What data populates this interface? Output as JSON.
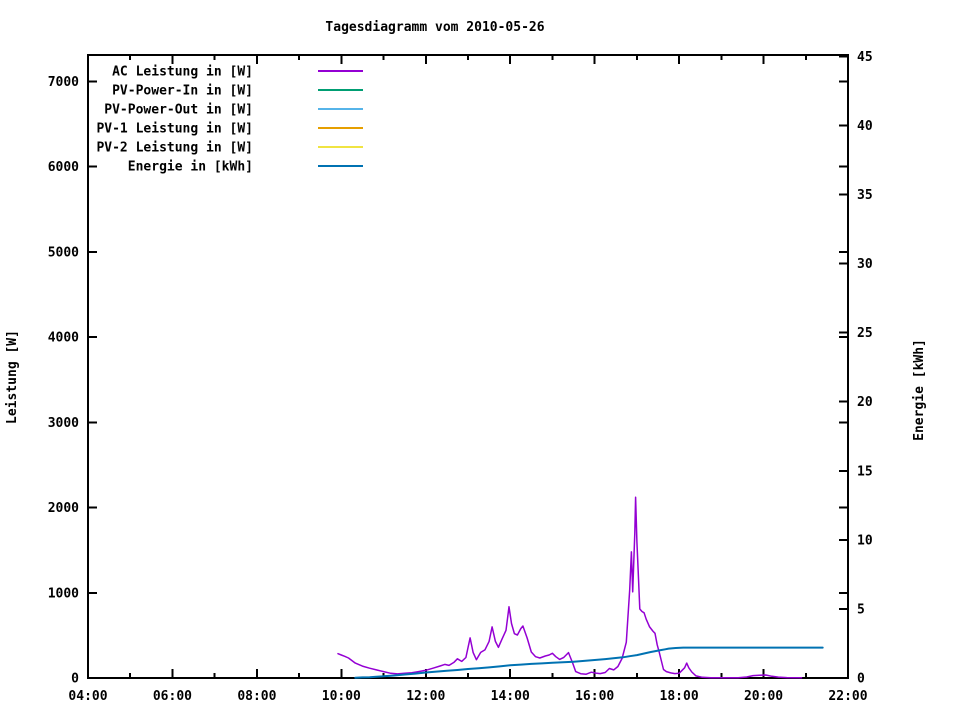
{
  "chart_data": {
    "type": "line",
    "title": "Tagesdiagramm vom 2010-05-26",
    "grid": false,
    "legend_position": "top-left-inside",
    "background_color": "#ffffff",
    "frame_color": "#000000",
    "x": {
      "range_hours": [
        4,
        22
      ],
      "tick_hours": [
        4,
        6,
        8,
        10,
        12,
        14,
        16,
        18,
        20,
        22
      ],
      "tick_labels": [
        "04:00",
        "06:00",
        "08:00",
        "10:00",
        "12:00",
        "14:00",
        "16:00",
        "18:00",
        "20:00",
        "22:00"
      ],
      "minor_tick_hours": [
        5,
        7,
        9,
        11,
        13,
        15,
        17,
        19,
        21
      ]
    },
    "y_left": {
      "label": "Leistung [W]",
      "ticks": [
        0,
        1000,
        2000,
        3000,
        4000,
        5000,
        6000,
        7000
      ],
      "range": [
        0,
        7310
      ]
    },
    "y_right": {
      "label": "Energie [kWh]",
      "ticks": [
        0,
        5,
        10,
        15,
        20,
        25,
        30,
        35,
        40,
        45
      ],
      "range": [
        0,
        45.1
      ]
    },
    "series": [
      {
        "name": "AC Leistung in [W]",
        "color": "#9400d3",
        "axis": "left",
        "points": [
          [
            9.92,
            285
          ],
          [
            10.0,
            270
          ],
          [
            10.08,
            255
          ],
          [
            10.17,
            235
          ],
          [
            10.33,
            175
          ],
          [
            10.5,
            140
          ],
          [
            10.67,
            115
          ],
          [
            10.83,
            95
          ],
          [
            11.0,
            75
          ],
          [
            11.17,
            55
          ],
          [
            11.33,
            48
          ],
          [
            11.5,
            55
          ],
          [
            11.67,
            62
          ],
          [
            11.83,
            75
          ],
          [
            12.0,
            90
          ],
          [
            12.17,
            115
          ],
          [
            12.33,
            140
          ],
          [
            12.45,
            160
          ],
          [
            12.55,
            148
          ],
          [
            12.67,
            185
          ],
          [
            12.75,
            225
          ],
          [
            12.85,
            195
          ],
          [
            12.95,
            240
          ],
          [
            13.05,
            470
          ],
          [
            13.12,
            300
          ],
          [
            13.2,
            215
          ],
          [
            13.3,
            300
          ],
          [
            13.4,
            330
          ],
          [
            13.5,
            430
          ],
          [
            13.57,
            600
          ],
          [
            13.65,
            430
          ],
          [
            13.72,
            360
          ],
          [
            13.8,
            450
          ],
          [
            13.9,
            560
          ],
          [
            13.97,
            835
          ],
          [
            14.03,
            640
          ],
          [
            14.1,
            520
          ],
          [
            14.17,
            505
          ],
          [
            14.25,
            580
          ],
          [
            14.3,
            610
          ],
          [
            14.4,
            470
          ],
          [
            14.5,
            305
          ],
          [
            14.6,
            250
          ],
          [
            14.7,
            235
          ],
          [
            14.83,
            258
          ],
          [
            14.92,
            270
          ],
          [
            15.0,
            290
          ],
          [
            15.08,
            250
          ],
          [
            15.17,
            218
          ],
          [
            15.27,
            242
          ],
          [
            15.38,
            298
          ],
          [
            15.48,
            175
          ],
          [
            15.55,
            75
          ],
          [
            15.67,
            50
          ],
          [
            15.8,
            45
          ],
          [
            15.92,
            68
          ],
          [
            16.03,
            58
          ],
          [
            16.13,
            52
          ],
          [
            16.25,
            65
          ],
          [
            16.35,
            112
          ],
          [
            16.45,
            95
          ],
          [
            16.55,
            135
          ],
          [
            16.65,
            230
          ],
          [
            16.75,
            420
          ],
          [
            16.83,
            1035
          ],
          [
            16.87,
            1480
          ],
          [
            16.9,
            1010
          ],
          [
            16.95,
            1700
          ],
          [
            16.97,
            2120
          ],
          [
            17.0,
            1600
          ],
          [
            17.03,
            1250
          ],
          [
            17.07,
            810
          ],
          [
            17.12,
            780
          ],
          [
            17.17,
            765
          ],
          [
            17.22,
            690
          ],
          [
            17.3,
            600
          ],
          [
            17.38,
            550
          ],
          [
            17.43,
            525
          ],
          [
            17.48,
            390
          ],
          [
            17.53,
            300
          ],
          [
            17.58,
            200
          ],
          [
            17.63,
            100
          ],
          [
            17.7,
            75
          ],
          [
            17.8,
            60
          ],
          [
            17.9,
            52
          ],
          [
            18.0,
            55
          ],
          [
            18.07,
            90
          ],
          [
            18.13,
            120
          ],
          [
            18.18,
            175
          ],
          [
            18.23,
            120
          ],
          [
            18.3,
            70
          ],
          [
            18.4,
            25
          ],
          [
            18.55,
            8
          ],
          [
            18.75,
            2
          ],
          [
            19.4,
            2
          ],
          [
            19.6,
            12
          ],
          [
            19.75,
            28
          ],
          [
            19.9,
            32
          ],
          [
            20.05,
            35
          ],
          [
            20.2,
            20
          ],
          [
            20.35,
            10
          ],
          [
            20.55,
            5
          ],
          [
            20.9,
            2
          ]
        ]
      },
      {
        "name": "PV-Power-In in [W]",
        "color": "#009e73",
        "axis": "left",
        "points": []
      },
      {
        "name": "PV-Power-Out in [W]",
        "color": "#56b4e9",
        "axis": "left",
        "points": []
      },
      {
        "name": "PV-1 Leistung in [W]",
        "color": "#e69f00",
        "axis": "left",
        "points": []
      },
      {
        "name": "PV-2 Leistung in [W]",
        "color": "#f0e442",
        "axis": "left",
        "points": []
      },
      {
        "name": "Energie in [kWh]",
        "color": "#0072b2",
        "axis": "right",
        "points": [
          [
            10.33,
            0.02
          ],
          [
            10.5,
            0.04
          ],
          [
            10.67,
            0.06
          ],
          [
            10.83,
            0.09
          ],
          [
            11.0,
            0.12
          ],
          [
            11.25,
            0.18
          ],
          [
            11.5,
            0.25
          ],
          [
            11.75,
            0.32
          ],
          [
            12.0,
            0.4
          ],
          [
            12.25,
            0.46
          ],
          [
            12.5,
            0.52
          ],
          [
            12.75,
            0.58
          ],
          [
            13.0,
            0.65
          ],
          [
            13.25,
            0.71
          ],
          [
            13.5,
            0.77
          ],
          [
            13.75,
            0.84
          ],
          [
            14.0,
            0.92
          ],
          [
            14.25,
            0.97
          ],
          [
            14.5,
            1.02
          ],
          [
            14.75,
            1.06
          ],
          [
            15.0,
            1.1
          ],
          [
            15.25,
            1.14
          ],
          [
            15.5,
            1.18
          ],
          [
            15.75,
            1.24
          ],
          [
            16.0,
            1.3
          ],
          [
            16.25,
            1.37
          ],
          [
            16.5,
            1.45
          ],
          [
            16.67,
            1.5
          ],
          [
            16.83,
            1.58
          ],
          [
            17.0,
            1.66
          ],
          [
            17.17,
            1.77
          ],
          [
            17.33,
            1.88
          ],
          [
            17.5,
            1.98
          ],
          [
            17.58,
            2.03
          ],
          [
            17.67,
            2.08
          ],
          [
            17.75,
            2.13
          ],
          [
            17.92,
            2.17
          ],
          [
            18.1,
            2.2
          ],
          [
            21.4,
            2.2
          ]
        ]
      }
    ]
  }
}
